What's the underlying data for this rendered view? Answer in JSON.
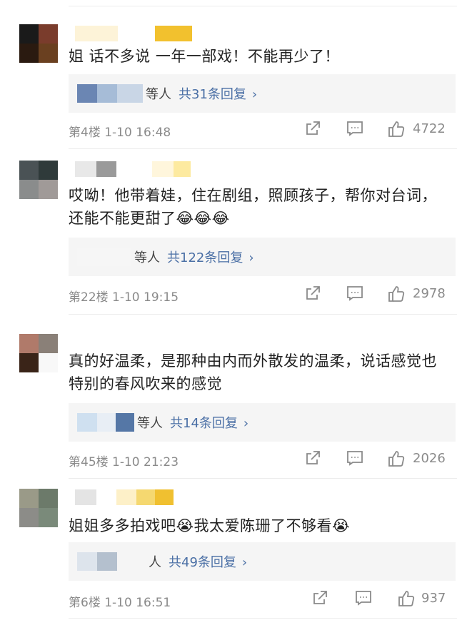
{
  "comments": [
    {
      "text": "姐 话不多说 一年一部戏！不能再少了！",
      "reply_people": "等人",
      "reply_link": "共31条回复",
      "floor_time": "第4楼 1-10 16:48",
      "likes": "4722",
      "avatar_colors": [
        "#1a1a1a",
        "#7a3c2c",
        "#2a1a10",
        "#6a4020"
      ],
      "name_colors": [
        "#fdf3d8",
        "#ffffff",
        "#f2c12e"
      ],
      "reply_colors": [
        "#6b86b3",
        "#a6bcd7",
        "#c9d6e6"
      ]
    },
    {
      "text": "哎呦！他带着娃，住在剧组，照顾孩子，帮你对台词，还能不能更甜了😂😂😂",
      "reply_people": "等人",
      "reply_link": "共122条回复",
      "floor_time": "第22楼 1-10 19:15",
      "likes": "2978",
      "avatar_colors": [
        "#4a5255",
        "#2f3a3a",
        "#8a8c8c",
        "#a09a98"
      ],
      "name_colors": [
        "#e8e8e8",
        "#9a9a9a",
        "#fff6dc",
        "#fdeaa0"
      ],
      "reply_colors": [
        "#f6f6f6",
        "#ffffff",
        "#f6f6f6"
      ]
    },
    {
      "text": "真的好温柔，是那种由内而外散发的温柔，说话感觉也特别的春风吹来的感觉",
      "reply_people": "等人",
      "reply_link": "共14条回复",
      "floor_time": "第45楼 1-10 21:23",
      "likes": "2026",
      "avatar_colors": [
        "#b07a6a",
        "#8a8078",
        "#3a2418",
        "#f8f8f8"
      ],
      "name_colors": [],
      "reply_colors": [
        "#cfe0f0",
        "#e8eef5",
        "#5577a6"
      ]
    },
    {
      "text": "姐姐多多拍戏吧😭我太爱陈珊了不够看😭",
      "reply_people": "人",
      "reply_link": "共49条回复",
      "floor_time": "第6楼 1-10 16:51",
      "likes": "937",
      "avatar_colors": [
        "#9a9a88",
        "#6c7a6a",
        "#8c8c88",
        "#7a8a7a"
      ],
      "name_colors": [
        "#e4e4e4",
        "#ffffff",
        "#fdf0c8",
        "#f5d870",
        "#f0c030"
      ],
      "reply_colors": [
        "#dde4ec",
        "#b4c0ce"
      ]
    }
  ],
  "icons": {
    "share": "share-icon",
    "comment": "comment-icon",
    "like": "thumbs-up-icon",
    "more": "chevron-right-icon"
  }
}
